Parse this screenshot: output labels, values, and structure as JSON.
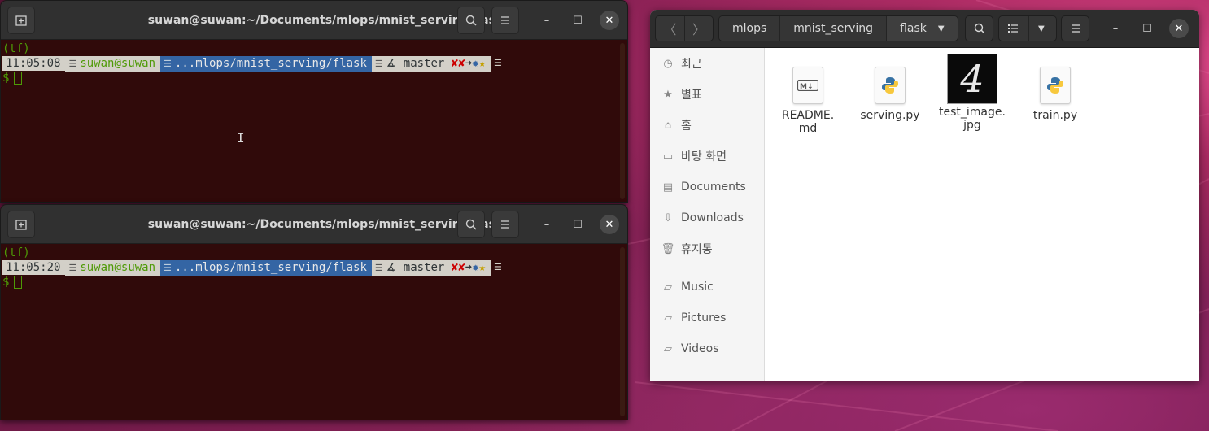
{
  "terminals": [
    {
      "title": "suwan@suwan:~/Documents/mlops/mnist_serving/flask",
      "env": "(tf)",
      "time": "11:05:08",
      "user": "suwan@suwan",
      "path": "...mlops/mnist_serving/flask",
      "branch": "master",
      "prompt": "$"
    },
    {
      "title": "suwan@suwan:~/Documents/mlops/mnist_serving/flask",
      "env": "(tf)",
      "time": "11:05:20",
      "user": "suwan@suwan",
      "path": "...mlops/mnist_serving/flask",
      "branch": "master",
      "prompt": "$"
    }
  ],
  "files_window": {
    "breadcrumbs": [
      "mlops",
      "mnist_serving",
      "flask"
    ],
    "sidebar": [
      {
        "label": "최근",
        "icon": "clock-icon"
      },
      {
        "label": "별표",
        "icon": "star-icon"
      },
      {
        "label": "홈",
        "icon": "home-icon"
      },
      {
        "label": "바탕 화면",
        "icon": "desktop-icon"
      },
      {
        "label": "Documents",
        "icon": "document-icon"
      },
      {
        "label": "Downloads",
        "icon": "download-icon"
      },
      {
        "label": "휴지통",
        "icon": "trash-icon"
      },
      {
        "label": "Music",
        "icon": "folder-icon"
      },
      {
        "label": "Pictures",
        "icon": "folder-icon"
      },
      {
        "label": "Videos",
        "icon": "folder-icon"
      }
    ],
    "files": [
      {
        "name_line1": "README.",
        "name_line2": "md",
        "icon": "markdown-file-icon"
      },
      {
        "name_line1": "serving.py",
        "name_line2": "",
        "icon": "python-file-icon"
      },
      {
        "name_line1": "test_image.",
        "name_line2": "jpg",
        "icon": "image-thumbnail"
      },
      {
        "name_line1": "train.py",
        "name_line2": "",
        "icon": "python-file-icon"
      }
    ],
    "thumbnail_glyph": "4"
  }
}
